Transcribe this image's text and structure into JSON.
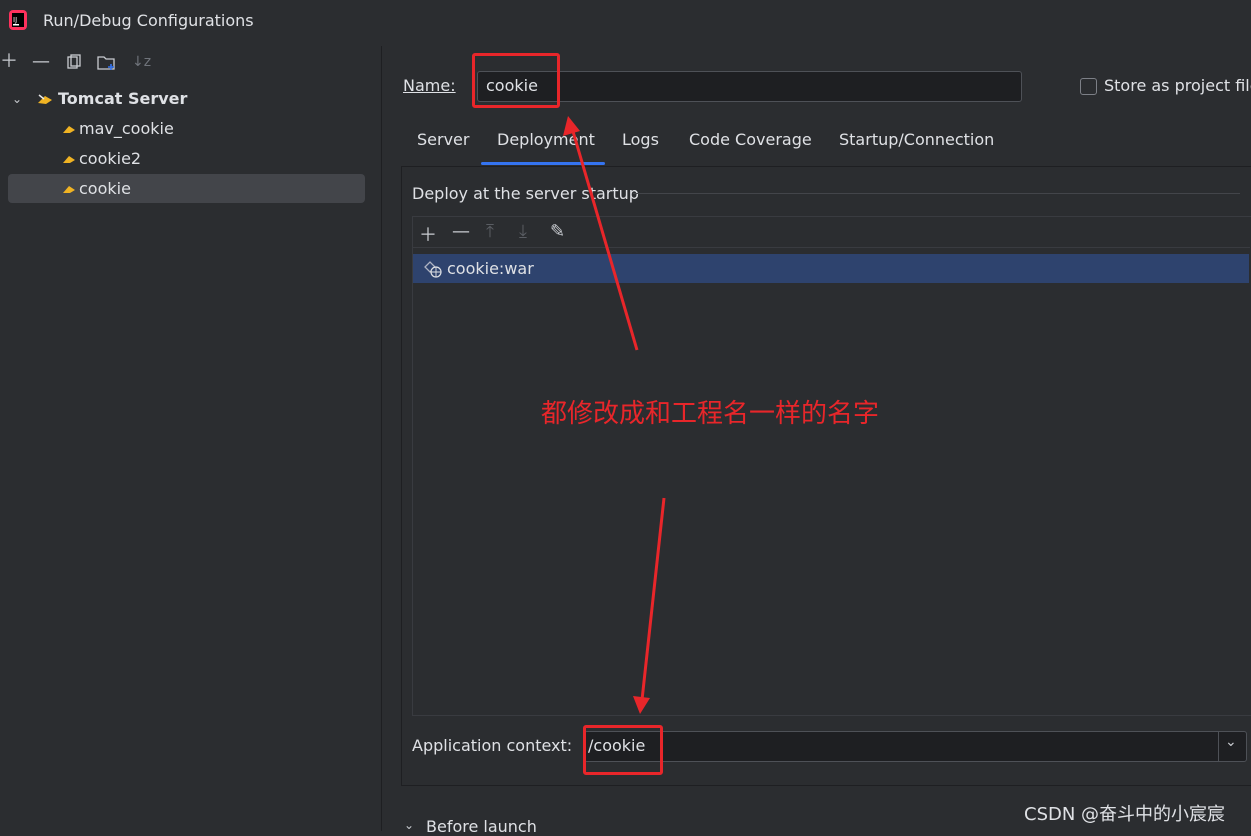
{
  "window": {
    "title": "Run/Debug Configurations"
  },
  "tree": {
    "group": "Tomcat Server",
    "items": [
      "mav_cookie",
      "cookie2",
      "cookie"
    ],
    "selected": "cookie"
  },
  "name_field": {
    "label": "Name:",
    "value": "cookie"
  },
  "store_checkbox": {
    "label": "Store as project file",
    "checked": false
  },
  "tabs": [
    "Server",
    "Deployment",
    "Logs",
    "Code Coverage",
    "Startup/Connection"
  ],
  "active_tab": "Deployment",
  "deploy": {
    "section_label": "Deploy at the server startup",
    "artifacts": [
      "cookie:war"
    ]
  },
  "app_context": {
    "label": "Application context:",
    "value": "/cookie"
  },
  "before_launch": "Before launch",
  "annotation": "都修改成和工程名一样的名字",
  "watermark": "CSDN @奋斗中的小宸宸",
  "colors": {
    "accent": "#3574f0",
    "annotation_red": "#e8262a",
    "selection": "#2e436e"
  }
}
